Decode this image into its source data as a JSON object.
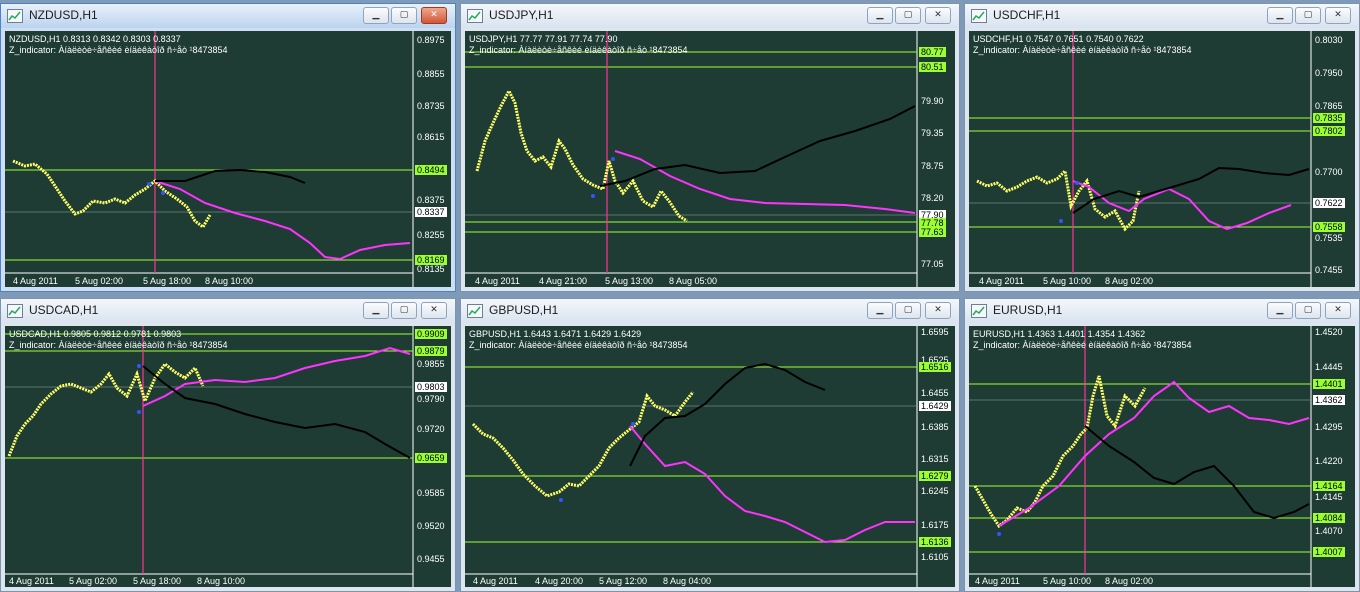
{
  "windows": [
    {
      "id": "nzdusd",
      "title": "NZDUSD,H1",
      "active": true,
      "ohlc": "NZDUSD,H1  0.8313 0.8342 0.8303 0.8337",
      "indicator": "Z_indicator: Àíàëèòè÷åñêèé èíäèêàòîð  ñ÷åò ¹8473854",
      "price_ticks": [
        "0.8975",
        "0.8855",
        "0.8735",
        "0.8615",
        "0.8494",
        "0.8375",
        "0.8337",
        "0.8255",
        "0.8169",
        "0.8135"
      ],
      "time_ticks": [
        "4 Aug 2011",
        "5 Aug 02:00",
        "5 Aug 18:00",
        "8 Aug 10:00"
      ],
      "levels": [
        {
          "value": "0.8494",
          "color": "#99ff33"
        },
        {
          "value": "0.8169",
          "color": "#99ff33"
        }
      ],
      "current": "0.8337"
    },
    {
      "id": "usdjpy",
      "title": "USDJPY,H1",
      "active": false,
      "ohlc": "USDJPY,H1  77.77 77.91 77.74 77.90",
      "indicator": "Z_indicator: Àíàëèòè÷åñêèé èíäèêàòîð  ñ÷åò ¹8473854",
      "price_ticks": [
        "80.77",
        "80.51",
        "79.90",
        "79.35",
        "78.75",
        "78.20",
        "77.90",
        "77.78",
        "77.63",
        "77.05"
      ],
      "time_ticks": [
        "4 Aug 2011",
        "4 Aug 21:00",
        "5 Aug 13:00",
        "8 Aug 05:00"
      ],
      "levels": [
        {
          "value": "80.77",
          "color": "#99ff33"
        },
        {
          "value": "80.51",
          "color": "#99ff33"
        },
        {
          "value": "77.78",
          "color": "#99ff33"
        },
        {
          "value": "77.63",
          "color": "#99ff33"
        }
      ],
      "current": "77.90"
    },
    {
      "id": "usdchf",
      "title": "USDCHF,H1",
      "active": false,
      "ohlc": "USDCHF,H1  0.7547 0.7651 0.7540 0.7622",
      "indicator": "Z_indicator: Àíàëèòè÷åñêèé èíäèêàòîð  ñ÷åò ¹8473854",
      "price_ticks": [
        "0.8030",
        "0.7950",
        "0.7865",
        "0.7835",
        "0.7802",
        "0.7700",
        "0.7622",
        "0.7558",
        "0.7535",
        "0.7455"
      ],
      "time_ticks": [
        "4 Aug 2011",
        "5 Aug 10:00",
        "8 Aug 02:00"
      ],
      "levels": [
        {
          "value": "0.7835",
          "color": "#99ff33"
        },
        {
          "value": "0.7802",
          "color": "#99ff33"
        },
        {
          "value": "0.7558",
          "color": "#99ff33"
        }
      ],
      "current": "0.7622"
    },
    {
      "id": "usdcad",
      "title": "USDCAD,H1",
      "active": false,
      "ohlc": "USDCAD,H1  0.9805 0.9812 0.9781 0.9803",
      "indicator": "Z_indicator: Àíàëèòè÷åñêèé èíäèêàòîð  ñ÷åò ¹8473854",
      "price_ticks": [
        "0.9909",
        "0.9879",
        "0.9855",
        "0.9803",
        "0.9790",
        "0.9720",
        "0.9659",
        "0.9585",
        "0.9520",
        "0.9455"
      ],
      "time_ticks": [
        "4 Aug 2011",
        "5 Aug 02:00",
        "5 Aug 18:00",
        "8 Aug 10:00"
      ],
      "levels": [
        {
          "value": "0.9909",
          "color": "#99ff33"
        },
        {
          "value": "0.9879",
          "color": "#99ff33"
        },
        {
          "value": "0.9659",
          "color": "#99ff33"
        }
      ],
      "current": "0.9803"
    },
    {
      "id": "gbpusd",
      "title": "GBPUSD,H1",
      "active": false,
      "ohlc": "GBPUSD,H1  1.6443 1.6471 1.6429 1.6429",
      "indicator": "Z_indicator: Àíàëèòè÷åñêèé èíäèêàòîð  ñ÷åò ¹8473854",
      "price_ticks": [
        "1.6595",
        "1.6525",
        "1.6516",
        "1.6455",
        "1.6429",
        "1.6385",
        "1.6315",
        "1.6279",
        "1.6245",
        "1.6175",
        "1.6136",
        "1.6105"
      ],
      "time_ticks": [
        "4 Aug 2011",
        "4 Aug 20:00",
        "5 Aug 12:00",
        "8 Aug 04:00"
      ],
      "levels": [
        {
          "value": "1.6516",
          "color": "#99ff33"
        },
        {
          "value": "1.6279",
          "color": "#99ff33"
        },
        {
          "value": "1.6136",
          "color": "#99ff33"
        }
      ],
      "current": "1.6429"
    },
    {
      "id": "eurusd",
      "title": "EURUSD,H1",
      "active": false,
      "ohlc": "EURUSD,H1  1.4363 1.4401 1.4354 1.4362",
      "indicator": "Z_indicator: Àíàëèòè÷åñêèé èíäèêàòîð  ñ÷åò ¹8473854",
      "price_ticks": [
        "1.4520",
        "1.4445",
        "1.4401",
        "1.4362",
        "1.4295",
        "1.4220",
        "1.4164",
        "1.4145",
        "1.4084",
        "1.4070",
        "1.4007"
      ],
      "time_ticks": [
        "4 Aug 2011",
        "5 Aug 10:00",
        "8 Aug 02:00"
      ],
      "levels": [
        {
          "value": "1.4401",
          "color": "#99ff33"
        },
        {
          "value": "1.4164",
          "color": "#99ff33"
        },
        {
          "value": "1.4084",
          "color": "#99ff33"
        },
        {
          "value": "1.4007",
          "color": "#99ff33"
        }
      ],
      "current": "1.4362"
    }
  ],
  "colors": {
    "chart_bg": "#1e3c34",
    "candles": "#ffff66",
    "forecast_magenta": "#ff33ff",
    "forecast_black": "#000000",
    "vline": "#ff3399",
    "level": "#99ff33",
    "current_bg": "#ffffff"
  },
  "icons": {
    "window": "chart-window-icon",
    "minimize": "minimize-icon",
    "maximize": "maximize-icon",
    "close": "close-icon"
  }
}
